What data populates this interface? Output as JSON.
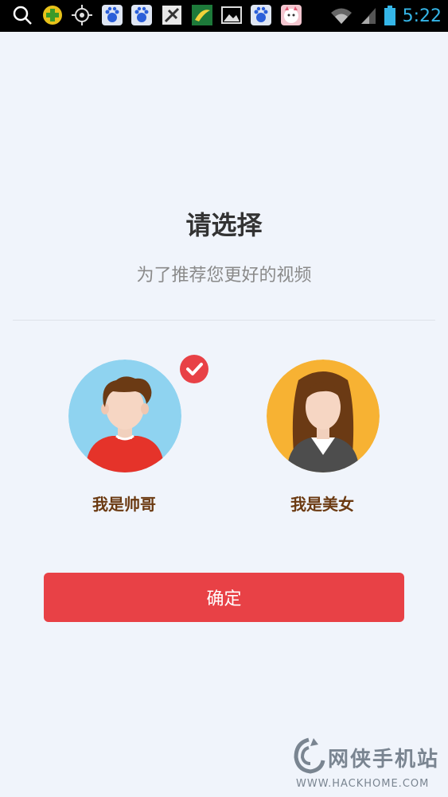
{
  "status_bar": {
    "time": "5:22",
    "clock_color": "#35b6e8",
    "icons": [
      "search-icon",
      "plus-app-icon",
      "gps-icon",
      "baidu-icon",
      "baidu-icon",
      "usb-debug-icon",
      "app-notification-icon",
      "image-icon",
      "baidu-icon",
      "cat-app-icon",
      "wifi-icon",
      "signal-icon",
      "battery-icon"
    ]
  },
  "page": {
    "title": "请选择",
    "subtitle": "为了推荐您更好的视频"
  },
  "options": [
    {
      "label": "我是帅哥",
      "selected": true
    },
    {
      "label": "我是美女",
      "selected": false
    }
  ],
  "confirm_label": "确定",
  "colors": {
    "accent": "#e84146",
    "background": "#f0f4fb",
    "male_avatar_bg": "#8fd3f0",
    "female_avatar_bg": "#f7b233",
    "label": "#6b3a12"
  },
  "watermark": {
    "text": "网侠手机站",
    "url": "WWW.HACKHOME.COM"
  }
}
